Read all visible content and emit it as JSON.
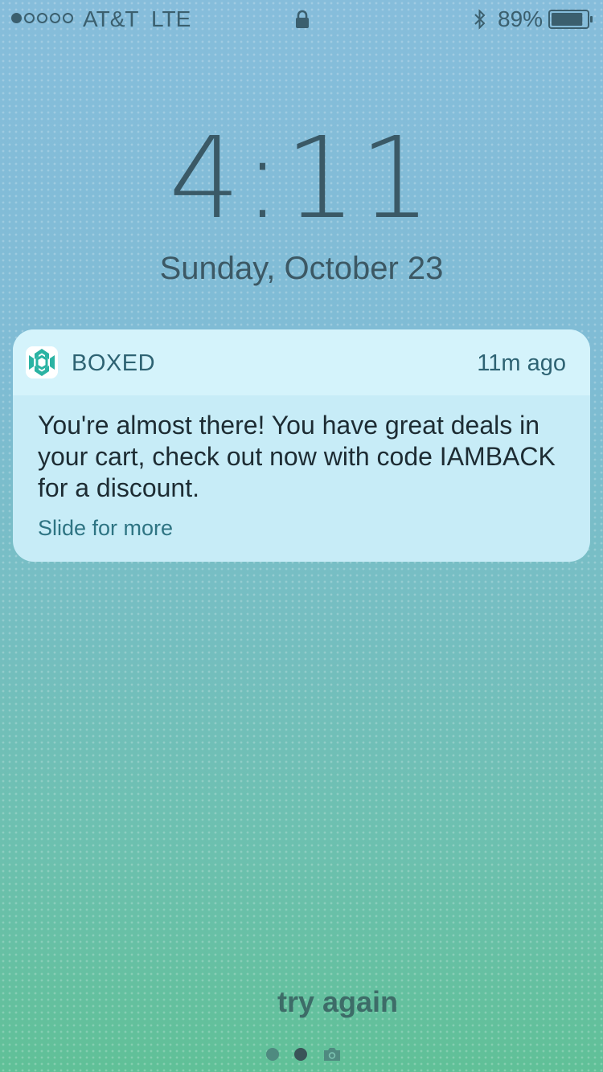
{
  "status_bar": {
    "carrier": "AT&T",
    "network": "LTE",
    "battery_percent": "89%",
    "signal_bars": 1,
    "signal_max": 5,
    "battery_level": 0.89,
    "icons": [
      "lock-icon",
      "bluetooth-icon",
      "battery-icon"
    ]
  },
  "lockscreen": {
    "time": "4:11",
    "date": "Sunday, October 23"
  },
  "notification": {
    "app_name": "BOXED",
    "app_icon": "boxed-app-icon",
    "time_ago": "11m ago",
    "message": "You're almost there! You have great deals in your cart, check out now with code IAMBACK for a discount.",
    "action_hint": "Slide for more"
  },
  "bottom": {
    "status_text": "try again",
    "pages": [
      "page-dot",
      "page-dot-active",
      "camera-icon"
    ]
  },
  "colors": {
    "accent": "#2bb3a3",
    "text_dark": "#3a5966"
  }
}
